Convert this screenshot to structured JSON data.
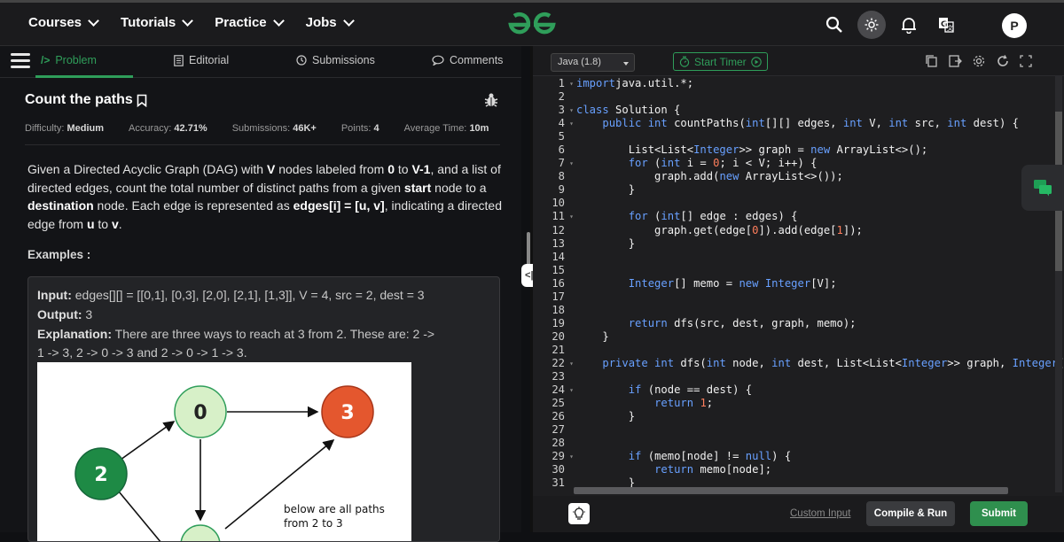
{
  "nav": {
    "items": [
      {
        "label": "Courses"
      },
      {
        "label": "Tutorials"
      },
      {
        "label": "Practice"
      },
      {
        "label": "Jobs"
      }
    ],
    "avatar_letter": "P"
  },
  "tabs": [
    {
      "label": "Problem",
      "icon": "code-icon",
      "active": true
    },
    {
      "label": "Editorial",
      "icon": "document-icon"
    },
    {
      "label": "Submissions",
      "icon": "clock-icon"
    },
    {
      "label": "Comments",
      "icon": "comment-icon"
    }
  ],
  "problem": {
    "title": "Count the paths",
    "meta": {
      "difficulty_label": "Difficulty:",
      "difficulty": "Medium",
      "accuracy_label": "Accuracy:",
      "accuracy": "42.71%",
      "submissions_label": "Submissions:",
      "submissions": "46K+",
      "points_label": "Points:",
      "points": "4",
      "avg_time_label": "Average Time:",
      "avg_time": "10m"
    },
    "description": {
      "p1": "Given a Directed Acyclic Graph (DAG) with ",
      "b1": "V",
      "p2": " nodes labeled from ",
      "b2": "0",
      "p3": " to ",
      "b3": "V-1",
      "p4": ", and a list of directed edges, count the total number of distinct paths from a given ",
      "b4": "start",
      "p5": " node to a ",
      "b5": "destination",
      "p6": " node. Each edge is represented as ",
      "b6": "edges[i] = [u, v]",
      "p7": ", indicating a directed edge from ",
      "b7": "u",
      "p8": " to ",
      "b8": "v",
      "p9": "."
    },
    "examples_heading": "Examples :",
    "example": {
      "input_label": "Input:",
      "input_value": " edges[][] = [[0,1], [0,3], [2,0], [2,1], [1,3]], V = 4, src = 2, dest = 3",
      "output_label": "Output:",
      "output_value": " 3",
      "explanation_label": "Explanation:",
      "explanation_line1": " There are three ways to reach at 3 from 2. These are: 2 ->",
      "explanation_line2": "1 -> 3, 2 -> 0 -> 3 and 2 -> 0 -> 1 -> 3.",
      "diagram": {
        "node_0": "0",
        "node_2": "2",
        "node_3": "3",
        "caption_line1": "below are all paths",
        "caption_line2": "from 2 to 3"
      }
    }
  },
  "editor": {
    "language": "Java (1.8)",
    "timer_label": "Start Timer",
    "lines": [
      [
        [
          "kw",
          "import"
        ],
        [
          "",
          "java.util.*;"
        ]
      ],
      [
        [
          "",
          ""
        ]
      ],
      [
        [
          "kw",
          "class"
        ],
        [
          "",
          " Solution {"
        ]
      ],
      [
        [
          "",
          "    "
        ],
        [
          "kw",
          "public int"
        ],
        [
          "",
          " countPaths("
        ],
        [
          "kw",
          "int"
        ],
        [
          "",
          "[][] edges, "
        ],
        [
          "kw",
          "int"
        ],
        [
          "",
          " V, "
        ],
        [
          "kw",
          "int"
        ],
        [
          "",
          " src, "
        ],
        [
          "kw",
          "int"
        ],
        [
          "",
          " dest) {"
        ]
      ],
      [
        [
          "",
          ""
        ]
      ],
      [
        [
          "",
          "        List<List<"
        ],
        [
          "kw",
          "Integer"
        ],
        [
          "",
          ">> graph = "
        ],
        [
          "kw",
          "new"
        ],
        [
          "",
          " ArrayList<>();"
        ]
      ],
      [
        [
          "",
          "        "
        ],
        [
          "kw",
          "for"
        ],
        [
          "",
          " ("
        ],
        [
          "kw",
          "int"
        ],
        [
          "",
          " i = "
        ],
        [
          "num",
          "0"
        ],
        [
          "",
          "; i < V; i++) {"
        ]
      ],
      [
        [
          "",
          "            graph.add("
        ],
        [
          "kw",
          "new"
        ],
        [
          "",
          " ArrayList<>());"
        ]
      ],
      [
        [
          "",
          "        }"
        ]
      ],
      [
        [
          "",
          ""
        ]
      ],
      [
        [
          "",
          "        "
        ],
        [
          "kw",
          "for"
        ],
        [
          "",
          " ("
        ],
        [
          "kw",
          "int"
        ],
        [
          "",
          "[] edge : edges) {"
        ]
      ],
      [
        [
          "",
          "            graph.get(edge["
        ],
        [
          "num",
          "0"
        ],
        [
          "",
          "]).add(edge["
        ],
        [
          "num",
          "1"
        ],
        [
          "",
          "]);"
        ]
      ],
      [
        [
          "",
          "        }"
        ]
      ],
      [
        [
          "",
          ""
        ]
      ],
      [
        [
          "",
          ""
        ]
      ],
      [
        [
          "",
          "        "
        ],
        [
          "kw",
          "Integer"
        ],
        [
          "",
          "[] memo = "
        ],
        [
          "kw",
          "new"
        ],
        [
          "",
          " "
        ],
        [
          "kw",
          "Integer"
        ],
        [
          "",
          "[V];"
        ]
      ],
      [
        [
          "",
          ""
        ]
      ],
      [
        [
          "",
          ""
        ]
      ],
      [
        [
          "",
          "        "
        ],
        [
          "kw",
          "return"
        ],
        [
          "",
          " dfs(src, dest, graph, memo);"
        ]
      ],
      [
        [
          "",
          "    }"
        ]
      ],
      [
        [
          "",
          ""
        ]
      ],
      [
        [
          "",
          "    "
        ],
        [
          "kw",
          "private int"
        ],
        [
          "",
          " dfs("
        ],
        [
          "kw",
          "int"
        ],
        [
          "",
          " node, "
        ],
        [
          "kw",
          "int"
        ],
        [
          "",
          " dest, List<List<"
        ],
        [
          "kw",
          "Integer"
        ],
        [
          "",
          ">> graph, "
        ],
        [
          "kw",
          "Integer"
        ],
        [
          "",
          "["
        ]
      ],
      [
        [
          "",
          ""
        ]
      ],
      [
        [
          "",
          "        "
        ],
        [
          "kw",
          "if"
        ],
        [
          "",
          " (node == dest) {"
        ]
      ],
      [
        [
          "",
          "            "
        ],
        [
          "kw",
          "return"
        ],
        [
          "",
          " "
        ],
        [
          "num",
          "1"
        ],
        [
          "",
          ";"
        ]
      ],
      [
        [
          "",
          "        }"
        ]
      ],
      [
        [
          "",
          ""
        ]
      ],
      [
        [
          "",
          ""
        ]
      ],
      [
        [
          "",
          "        "
        ],
        [
          "kw",
          "if"
        ],
        [
          "",
          " (memo[node] != "
        ],
        [
          "kw",
          "null"
        ],
        [
          "",
          ") {"
        ]
      ],
      [
        [
          "",
          "            "
        ],
        [
          "kw",
          "return"
        ],
        [
          "",
          " memo[node];"
        ]
      ],
      [
        [
          "",
          "        }"
        ]
      ]
    ],
    "fold_lines": [
      1,
      3,
      4,
      7,
      11,
      22,
      24,
      29
    ]
  },
  "bottom": {
    "custom_input": "Custom Input",
    "compile_run": "Compile & Run",
    "submit": "Submit"
  },
  "colors": {
    "brand_green": "#2f9e5a",
    "keyword_blue": "#68a0ff",
    "number_orange": "#ff7e5c",
    "node_green": "#1e8a45",
    "node_light": "#d7f0c8",
    "node_orange": "#e4572e"
  }
}
